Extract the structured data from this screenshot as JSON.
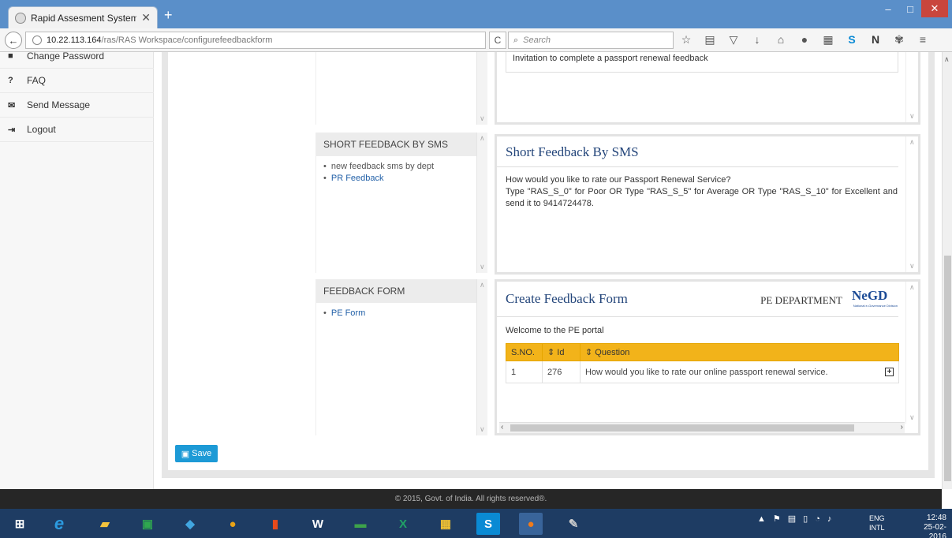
{
  "browser": {
    "tab_title": "Rapid Assesment System: ...",
    "tab_close": "✕",
    "new_tab": "+",
    "win_min": "–",
    "win_max": "□",
    "win_close": "✕",
    "url_host": "10.22.113.164",
    "url_path": "/ras/RAS Workspace/configurefeedbackform",
    "search_placeholder": "Search",
    "reload": "C"
  },
  "sidebar": {
    "items": [
      {
        "label": "Change Password",
        "icon": "lock-icon",
        "glyph": "■"
      },
      {
        "label": "FAQ",
        "icon": "question-icon",
        "glyph": "?"
      },
      {
        "label": "Send Message",
        "icon": "envelope-icon",
        "glyph": "✉"
      },
      {
        "label": "Logout",
        "icon": "sign-out-icon",
        "glyph": "⇥"
      }
    ]
  },
  "panels": {
    "email_card": {
      "invite_text": "Invitation to complete a passport renewal feedback"
    },
    "sms_list": {
      "heading": "SHORT FEEDBACK BY SMS",
      "items": [
        "new feedback sms by dept",
        "PR Feedback"
      ]
    },
    "sms_card": {
      "title": "Short Feedback By SMS",
      "line1": "How would you like to rate our Passport Renewal Service?",
      "line2": "Type \"RAS_S_0\" for Poor OR Type \"RAS_S_5\" for Average OR Type \"RAS_S_10\" for Excellent and send it to 9414724478."
    },
    "form_list": {
      "heading": "FEEDBACK FORM",
      "items": [
        "PE Form"
      ]
    },
    "form_card": {
      "title": "Create Feedback Form",
      "dept": "PE DEPARTMENT",
      "logo": "NeGD",
      "logo_sub": "National e-Governance Division",
      "welcome": "Welcome to the PE portal",
      "columns": [
        "S.NO.",
        "Id",
        "Question"
      ],
      "rows": [
        {
          "sno": "1",
          "id": "276",
          "question": "How would you like to rate our online passport renewal service.",
          "action": "+"
        }
      ]
    }
  },
  "save_label": "Save",
  "footer": "© 2015, Govt. of India. All rights reserved®.",
  "taskbar": {
    "lang": "ENG",
    "lang_sub": "INTL",
    "time": "12:48",
    "date": "25-02-2016"
  },
  "colors": {
    "title_bar": "#5a8fc9",
    "table_header": "#f2b31a",
    "save_button": "#1d9ad6",
    "footer": "#262626",
    "taskbar": "#1e3c63"
  }
}
